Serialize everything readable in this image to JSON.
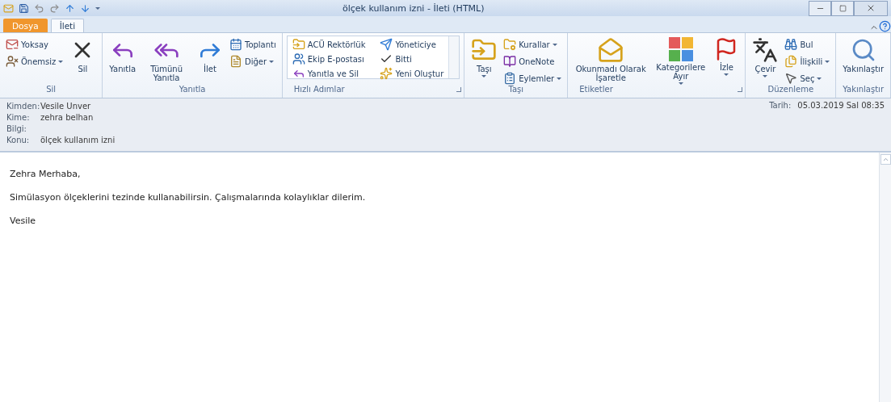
{
  "window": {
    "title": "ölçek kullanım izni - İleti (HTML)"
  },
  "tabs": [
    {
      "label": "Dosya",
      "kind": "file",
      "selected": false
    },
    {
      "label": "İleti",
      "kind": "normal",
      "selected": true
    }
  ],
  "ribbon": {
    "groups": [
      {
        "label": "Sil",
        "launcher": false,
        "items": [
          {
            "kind": "column",
            "buttons": [
              {
                "label": "Yoksay",
                "dropdown": false
              },
              {
                "label": "Önemsiz",
                "dropdown": true
              }
            ]
          },
          {
            "kind": "large",
            "label": "Sil",
            "dropdown": false
          }
        ]
      },
      {
        "label": "Yanıtla",
        "launcher": false,
        "items": [
          {
            "kind": "large",
            "label": "Yanıtla",
            "dropdown": false
          },
          {
            "kind": "large",
            "label": "Tümünü Yanıtla",
            "dropdown": false
          },
          {
            "kind": "large",
            "label": "İlet",
            "dropdown": false
          },
          {
            "kind": "column",
            "buttons": [
              {
                "label": "Toplantı",
                "dropdown": false
              },
              {
                "label": "Diğer",
                "dropdown": true
              }
            ]
          }
        ]
      },
      {
        "label": "Hızlı Adımlar",
        "launcher": true,
        "items": [
          {
            "kind": "gallery",
            "buttons": [
              {
                "label": "ACÜ Rektörlük",
                "dropdown": false
              },
              {
                "label": "Ekip E-postası",
                "dropdown": false
              },
              {
                "label": "Yanıtla ve Sil",
                "dropdown": false
              },
              {
                "label": "Yöneticiye",
                "dropdown": false
              },
              {
                "label": "Bitti",
                "dropdown": false
              },
              {
                "label": "Yeni Oluştur",
                "dropdown": false
              }
            ]
          }
        ]
      },
      {
        "label": "Taşı",
        "launcher": false,
        "items": [
          {
            "kind": "large",
            "label": "Taşı",
            "dropdown": true
          },
          {
            "kind": "column",
            "buttons": [
              {
                "label": "Kurallar",
                "dropdown": true
              },
              {
                "label": "OneNote",
                "dropdown": false
              },
              {
                "label": "Eylemler",
                "dropdown": true
              }
            ]
          }
        ]
      },
      {
        "label": "Etiketler",
        "launcher": true,
        "items": [
          {
            "kind": "large",
            "label": "Okunmadı Olarak İşaretle",
            "dropdown": false
          },
          {
            "kind": "large",
            "label": "Kategorilere Ayır",
            "dropdown": true
          },
          {
            "kind": "large",
            "label": "İzle",
            "dropdown": true
          }
        ]
      },
      {
        "label": "Düzenleme",
        "launcher": false,
        "items": [
          {
            "kind": "large",
            "label": "Çevir",
            "dropdown": true
          },
          {
            "kind": "column",
            "buttons": [
              {
                "label": "Bul",
                "dropdown": false
              },
              {
                "label": "İlişkili",
                "dropdown": true
              },
              {
                "label": "Seç",
                "dropdown": true
              }
            ]
          }
        ]
      },
      {
        "label": "Yakınlaştır",
        "launcher": false,
        "items": [
          {
            "kind": "large",
            "label": "Yakınlaştır",
            "dropdown": false
          }
        ]
      }
    ]
  },
  "header": {
    "fields": [
      {
        "label": "Kimden:",
        "value": "Vesile Unver"
      },
      {
        "label": "Kime:",
        "value": "zehra belhan"
      },
      {
        "label": "Bilgi:"
      },
      {
        "label": "Konu:",
        "value": "ölçek kullanım izni"
      }
    ],
    "date": {
      "label": "Tarih:",
      "value": "05.03.2019 Sal 08:35"
    }
  },
  "body": {
    "paragraphs": [
      "Zehra Merhaba,",
      "Simülasyon ölçeklerini tezinde kullanabilirsin. Çalışmalarında kolaylıklar dilerim.",
      "Vesile"
    ]
  }
}
